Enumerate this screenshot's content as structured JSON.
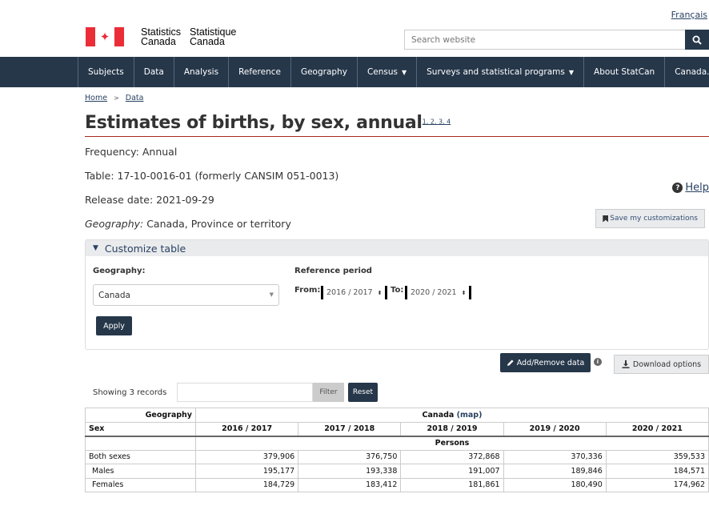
{
  "header": {
    "language_link": "Français",
    "wordmark_en_1": "Statistics",
    "wordmark_en_2": "Canada",
    "wordmark_fr_1": "Statistique",
    "wordmark_fr_2": "Canada",
    "search_placeholder": "Search website"
  },
  "nav": [
    {
      "label": "Subjects",
      "has_menu": false
    },
    {
      "label": "Data",
      "has_menu": false
    },
    {
      "label": "Analysis",
      "has_menu": false
    },
    {
      "label": "Reference",
      "has_menu": false
    },
    {
      "label": "Geography",
      "has_menu": false
    },
    {
      "label": "Census",
      "has_menu": true
    },
    {
      "label": "Surveys and statistical programs",
      "has_menu": true
    },
    {
      "label": "About StatCan",
      "has_menu": false
    },
    {
      "label": "Canada.ca",
      "has_menu": false
    }
  ],
  "breadcrumb": {
    "home": "Home",
    "data": "Data"
  },
  "page": {
    "title": "Estimates of births, by sex, annual",
    "footnotes": "1, 2, 3, 4",
    "frequency": "Frequency: Annual",
    "table_id": "Table: 17-10-0016-01 (formerly CANSIM 051-0013)",
    "release_date": "Release date: 2021-09-29",
    "geography_label": "Geography:",
    "geography_value": " Canada, Province or territory",
    "help": "Help",
    "save": "Save my customizations"
  },
  "customize": {
    "header": "Customize table",
    "geo_label": "Geography:",
    "geo_value": "Canada",
    "ref_label": "Reference period",
    "from_label": "From:",
    "from_value": "2016 / 2017",
    "to_label": "To:",
    "to_value": "2020 / 2021",
    "apply": "Apply"
  },
  "actions": {
    "add_remove": "Add/Remove data",
    "download": "Download options",
    "showing": "Showing 3 records",
    "filter": "Filter",
    "reset": "Reset"
  },
  "table": {
    "geo_header": "Geography",
    "geo_value": "Canada",
    "map_link": "(map)",
    "sex_header": "Sex",
    "years": [
      "2016 / 2017",
      "2017 / 2018",
      "2018 / 2019",
      "2019 / 2020",
      "2020 / 2021"
    ],
    "unit": "Persons",
    "rows": [
      {
        "label": "Both sexes",
        "values": [
          "379,906",
          "376,750",
          "372,868",
          "370,336",
          "359,533"
        ]
      },
      {
        "label": "Males",
        "values": [
          "195,177",
          "193,338",
          "191,007",
          "189,846",
          "184,571"
        ]
      },
      {
        "label": "Females",
        "values": [
          "184,729",
          "183,412",
          "181,861",
          "180,490",
          "174,962"
        ]
      }
    ]
  },
  "colors": {
    "nav_bg": "#26374a",
    "flag_red": "#eb2d37",
    "link": "#284162",
    "title_rule": "#a62a1e"
  }
}
